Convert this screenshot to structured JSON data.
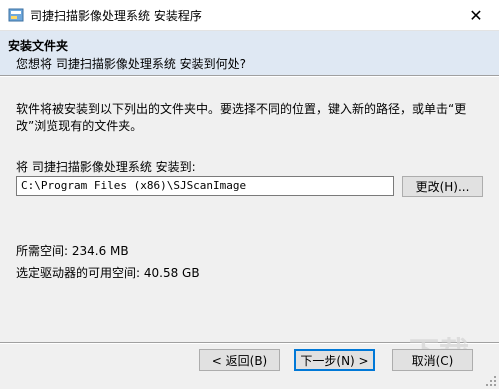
{
  "window": {
    "title": "司捷扫描影像处理系统 安装程序",
    "close_glyph": "✕"
  },
  "header": {
    "title": "安装文件夹",
    "subtitle": "您想将 司捷扫描影像处理系统 安装到何处?"
  },
  "body": {
    "instructions": "软件将被安装到以下列出的文件夹中。要选择不同的位置，键入新的路径，或单击“更改”浏览现有的文件夹。",
    "path_label": "将 司捷扫描影像处理系统 安装到:",
    "path_value": "C:\\Program Files (x86)\\SJScanImage",
    "browse_label": "更改(H)...",
    "space_required": "所需空间: 234.6 MB",
    "space_available": "选定驱动器的可用空间: 40.58 GB"
  },
  "footer": {
    "back_label": "< 返回(B)",
    "next_label": "下一步(N) >",
    "cancel_label": "取消(C)"
  },
  "colors": {
    "header_bg": "#dfe8f3",
    "focus_border": "#0078d7",
    "button_bg": "#e1e1e1"
  }
}
